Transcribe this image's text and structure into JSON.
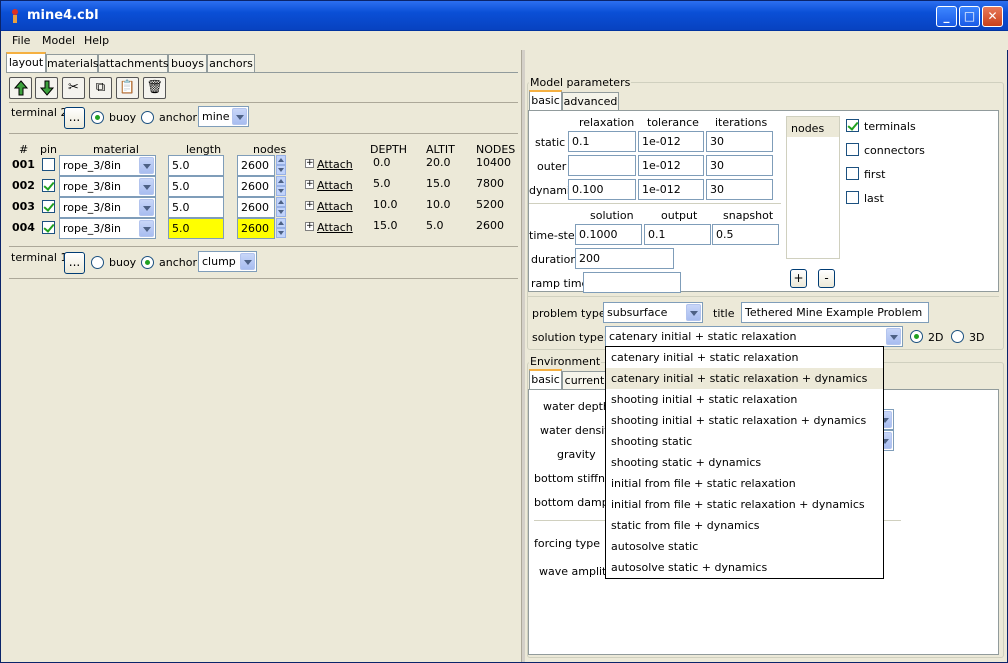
{
  "window": {
    "title": "mine4.cbl"
  },
  "menu": [
    "File",
    "Model",
    "Help"
  ],
  "left_tabs": [
    "layout",
    "materials",
    "attachments",
    "buoys",
    "anchors"
  ],
  "terminal2": {
    "label": "terminal 2",
    "browse": "...",
    "buoy": "buoy",
    "anchor": "anchor",
    "selected": "buoy",
    "combo": "mine"
  },
  "terminal1": {
    "label": "terminal 1",
    "browse": "...",
    "buoy": "buoy",
    "anchor": "anchor",
    "selected": "anchor",
    "combo": "clump"
  },
  "segments": {
    "headers": [
      "#",
      "pin",
      "material",
      "length",
      "nodes",
      "",
      "DEPTH",
      "ALTIT",
      "NODES"
    ],
    "attach_label": "Attach",
    "rows": [
      {
        "id": "001",
        "pin": false,
        "material": "rope_3/8in",
        "length": "5.0",
        "nodes": "2600",
        "depth": "0.0",
        "altit": "20.0",
        "total": "10400",
        "hl": false
      },
      {
        "id": "002",
        "pin": true,
        "material": "rope_3/8in",
        "length": "5.0",
        "nodes": "2600",
        "depth": "5.0",
        "altit": "15.0",
        "total": "7800",
        "hl": false
      },
      {
        "id": "003",
        "pin": true,
        "material": "rope_3/8in",
        "length": "5.0",
        "nodes": "2600",
        "depth": "10.0",
        "altit": "10.0",
        "total": "5200",
        "hl": false
      },
      {
        "id": "004",
        "pin": true,
        "material": "rope_3/8in",
        "length": "5.0",
        "nodes": "2600",
        "depth": "15.0",
        "altit": "5.0",
        "total": "2600",
        "hl": true
      }
    ]
  },
  "model": {
    "title": "Model parameters",
    "tabs": [
      "basic",
      "advanced"
    ],
    "cols": [
      "relaxation",
      "tolerance",
      "iterations"
    ],
    "rows": [
      {
        "label": "static",
        "vals": [
          "0.1",
          "1e-012",
          "30"
        ]
      },
      {
        "label": "outer",
        "vals": [
          "",
          "1e-012",
          "30"
        ]
      },
      {
        "label": "dynamic",
        "vals": [
          "0.100",
          "1e-012",
          "30"
        ]
      }
    ],
    "time_cols": [
      "solution",
      "output",
      "snapshot"
    ],
    "timestep_label": "time-step",
    "timestep": [
      "0.1000",
      "0.1",
      "0.5"
    ],
    "duration_label": "duration",
    "duration": "200",
    "ramp_label": "ramp time",
    "ramp": "",
    "nodes_header": "nodes",
    "node_opts": [
      {
        "label": "terminals",
        "on": true
      },
      {
        "label": "connectors",
        "on": false
      },
      {
        "label": "first",
        "on": false
      },
      {
        "label": "last",
        "on": false
      }
    ],
    "plus": "+",
    "minus": "-",
    "problem_label": "problem type",
    "problem": "subsurface",
    "title_label": "title",
    "title_val": "Tethered Mine Example Problem",
    "solution_label": "solution type:",
    "solution": "catenary initial + static relaxation",
    "dim2": "2D",
    "dim3": "3D"
  },
  "dropdown": {
    "options": [
      "catenary initial + static relaxation",
      "catenary initial + static relaxation + dynamics",
      "shooting initial + static relaxation",
      "shooting initial + static relaxation + dynamics",
      "shooting static",
      "shooting static + dynamics",
      "initial from file + static relaxation",
      "initial from file + static relaxation + dynamics",
      "static from file + dynamics",
      "autosolve static",
      "autosolve static + dynamics"
    ],
    "highlight": 1
  },
  "env": {
    "title": "Environment",
    "tabs": [
      "basic",
      "current"
    ],
    "labels": [
      "water depth",
      "water density",
      "gravity",
      "bottom stiffnes",
      "bottom dampin",
      "forcing type",
      "wave amplitu"
    ]
  }
}
